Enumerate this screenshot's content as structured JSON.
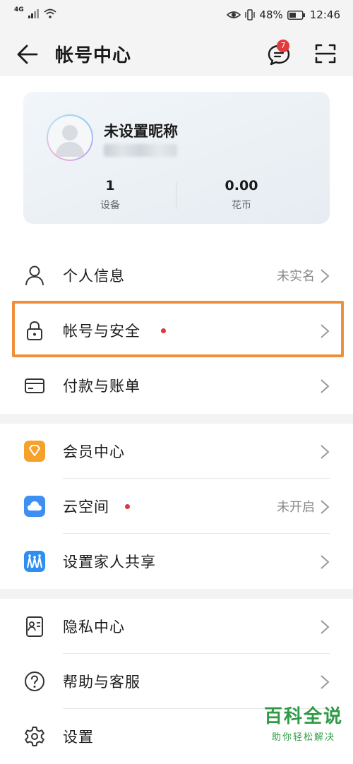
{
  "status_bar": {
    "network": "4G",
    "battery": "48%",
    "time": "12:46"
  },
  "header": {
    "title": "帐号中心",
    "message_badge": "7"
  },
  "profile": {
    "nickname": "未设置昵称",
    "stats": [
      {
        "value": "1",
        "label": "设备"
      },
      {
        "value": "0.00",
        "label": "花币"
      }
    ]
  },
  "menu": {
    "personal_info": {
      "label": "个人信息",
      "value": "未实名",
      "icon": "person-icon"
    },
    "account_security": {
      "label": "帐号与安全",
      "icon": "lock-icon"
    },
    "payment": {
      "label": "付款与账单",
      "icon": "card-icon"
    },
    "membership": {
      "label": "会员中心",
      "icon": "diamond-icon"
    },
    "cloud": {
      "label": "云空间",
      "value": "未开启",
      "icon": "cloud-icon"
    },
    "family": {
      "label": "设置家人共享",
      "icon": "family-icon"
    },
    "privacy": {
      "label": "隐私中心",
      "icon": "privacy-icon"
    },
    "help": {
      "label": "帮助与客服",
      "icon": "help-icon"
    },
    "settings": {
      "label": "设置",
      "icon": "gear-icon"
    }
  },
  "colors": {
    "highlight": "#ee8f3a",
    "red_dot": "#d93a3a",
    "watermark": "#2e9a46"
  },
  "watermark": {
    "title": "百科全说",
    "subtitle": "助你轻松解决"
  }
}
